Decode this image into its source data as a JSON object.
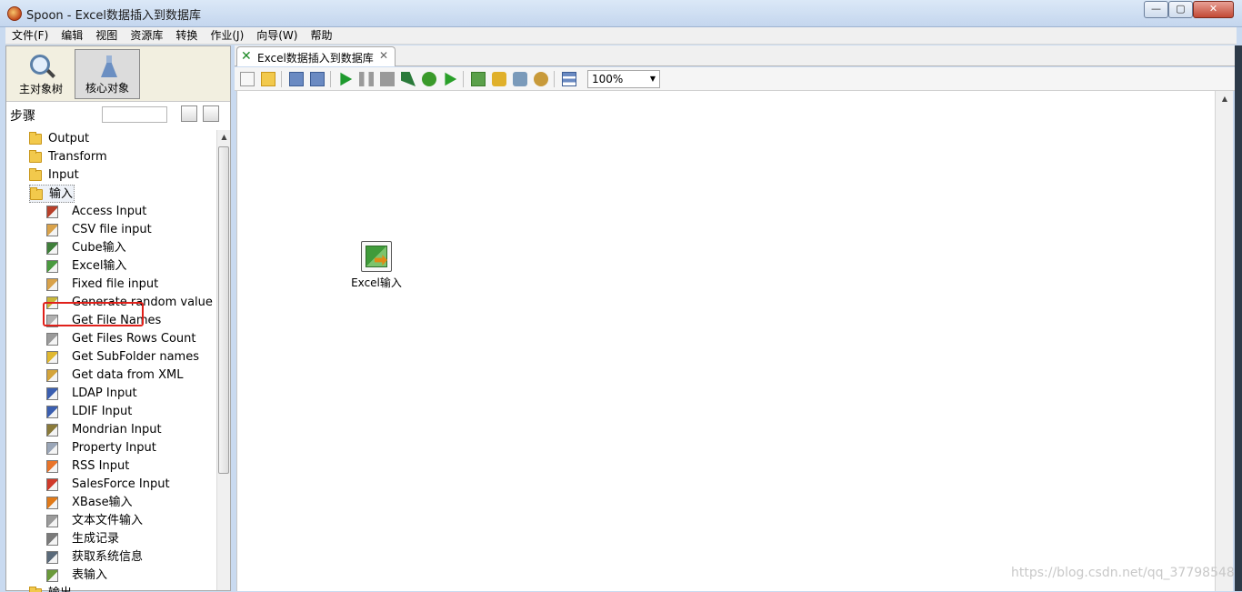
{
  "window": {
    "title": "Spoon - Excel数据插入到数据库",
    "minimize": "—",
    "maximize": "▢",
    "close": "✕"
  },
  "menu": [
    "文件(F)",
    "编辑",
    "视图",
    "资源库",
    "转换",
    "作业(J)",
    "向导(W)",
    "帮助"
  ],
  "left_tabs": {
    "main_tree": "主对象树",
    "core_objects": "核心对象"
  },
  "steps_label": "步骤",
  "tree": {
    "categories_top": [
      "Output",
      "Transform",
      "Input",
      "输入"
    ],
    "input_steps": [
      {
        "label": "Access Input",
        "icon": "access-input-icon",
        "color": "#b8402a"
      },
      {
        "label": "CSV file input",
        "icon": "csv-file-icon",
        "color": "#d9a24a"
      },
      {
        "label": "Cube输入",
        "icon": "cube-input-icon",
        "color": "#3f7f3a"
      },
      {
        "label": "Excel输入",
        "icon": "excel-input-icon",
        "color": "#4a9a3f"
      },
      {
        "label": "Fixed file input",
        "icon": "fixed-file-icon",
        "color": "#d9a24a"
      },
      {
        "label": "Generate random value",
        "icon": "random-value-icon",
        "color": "#c8b63a"
      },
      {
        "label": "Get File Names",
        "icon": "file-names-icon",
        "color": "#b0b0b0"
      },
      {
        "label": "Get Files Rows Count",
        "icon": "rows-count-icon",
        "color": "#9a9a9a"
      },
      {
        "label": "Get SubFolder names",
        "icon": "subfolder-icon",
        "color": "#e0b830"
      },
      {
        "label": "Get data from XML",
        "icon": "xml-data-icon",
        "color": "#d4a43a"
      },
      {
        "label": "LDAP Input",
        "icon": "ldap-input-icon",
        "color": "#3b5fb0"
      },
      {
        "label": "LDIF Input",
        "icon": "ldif-input-icon",
        "color": "#3b5fb0"
      },
      {
        "label": "Mondrian Input",
        "icon": "mondrian-input-icon",
        "color": "#8a7a3a"
      },
      {
        "label": "Property Input",
        "icon": "property-input-icon",
        "color": "#9aa6b8"
      },
      {
        "label": "RSS Input",
        "icon": "rss-input-icon",
        "color": "#e8742a"
      },
      {
        "label": "SalesForce Input",
        "icon": "salesforce-input-icon",
        "color": "#d03a2a"
      },
      {
        "label": "XBase输入",
        "icon": "xbase-input-icon",
        "color": "#e07a1a"
      },
      {
        "label": "文本文件输入",
        "icon": "text-file-input-icon",
        "color": "#9a9a9a"
      },
      {
        "label": "生成记录",
        "icon": "generate-rows-icon",
        "color": "#7a7a7a"
      },
      {
        "label": "获取系统信息",
        "icon": "system-info-icon",
        "color": "#5a6a7a"
      },
      {
        "label": "表输入",
        "icon": "table-input-icon",
        "color": "#6a9a3a"
      }
    ],
    "next_category": "输出"
  },
  "doc_tab": {
    "label": "Excel数据插入到数据库",
    "close": "✕"
  },
  "toolbar": {
    "zoom": "100%"
  },
  "canvas": {
    "step_label": "Excel输入"
  },
  "watermark": "https://blog.csdn.net/qq_37798548",
  "colors": {
    "highlight": "#e0201a",
    "titlebar": "#c4d6ee"
  }
}
